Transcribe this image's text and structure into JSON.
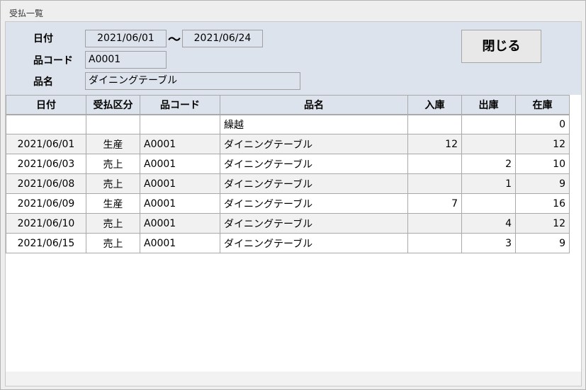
{
  "window": {
    "title": "受払一覧"
  },
  "filter": {
    "date_label": "日付",
    "date_from": "2021/06/01",
    "tilde": "～",
    "date_to": "2021/06/24",
    "code_label": "品コード",
    "code_value": "A0001",
    "name_label": "品名",
    "name_value": "ダイニングテーブル"
  },
  "close_button_label": "閉じる",
  "table": {
    "headers": [
      "日付",
      "受払区分",
      "品コード",
      "品名",
      "入庫",
      "出庫",
      "在庫"
    ],
    "rows": [
      [
        "",
        "",
        "",
        "繰越",
        "",
        "",
        "0"
      ],
      [
        "2021/06/01",
        "生産",
        "A0001",
        "ダイニングテーブル",
        "12",
        "",
        "12"
      ],
      [
        "2021/06/03",
        "売上",
        "A0001",
        "ダイニングテーブル",
        "",
        "2",
        "10"
      ],
      [
        "2021/06/08",
        "売上",
        "A0001",
        "ダイニングテーブル",
        "",
        "1",
        "9"
      ],
      [
        "2021/06/09",
        "生産",
        "A0001",
        "ダイニングテーブル",
        "7",
        "",
        "16"
      ],
      [
        "2021/06/10",
        "売上",
        "A0001",
        "ダイニングテーブル",
        "",
        "4",
        "12"
      ],
      [
        "2021/06/15",
        "売上",
        "A0001",
        "ダイニングテーブル",
        "",
        "3",
        "9"
      ]
    ]
  }
}
